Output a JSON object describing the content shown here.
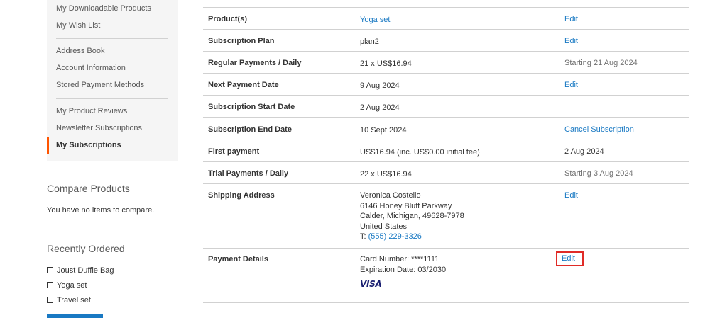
{
  "sidebar": {
    "nav_items": [
      "My Downloadable Products",
      "My Wish List",
      "Address Book",
      "Account Information",
      "Stored Payment Methods",
      "My Product Reviews",
      "Newsletter Subscriptions",
      "My Subscriptions"
    ],
    "compare": {
      "title": "Compare Products",
      "empty_text": "You have no items to compare."
    },
    "recently_ordered": {
      "title": "Recently Ordered",
      "items": [
        "Joust Duffle Bag",
        "Yoga set",
        "Travel set"
      ]
    }
  },
  "subscription": {
    "rows": [
      {
        "label": "Product(s)",
        "value": "Yoga set",
        "action": "Edit"
      },
      {
        "label": "Subscription Plan",
        "value": "plan2",
        "action": "Edit"
      },
      {
        "label": "Regular Payments / Daily",
        "value": "21 x US$16.94",
        "action": "Starting 21 Aug 2024"
      },
      {
        "label": "Next Payment Date",
        "value": "9 Aug 2024",
        "action": "Edit"
      },
      {
        "label": "Subscription Start Date",
        "value": "2 Aug 2024",
        "action": ""
      },
      {
        "label": "Subscription End Date",
        "value": "10 Sept 2024",
        "action": "Cancel Subscription"
      },
      {
        "label": "First payment",
        "value": "US$16.94 (inc. US$0.00 initial fee)",
        "action": "2 Aug 2024"
      },
      {
        "label": "Trial Payments / Daily",
        "value": "22 x US$16.94",
        "action": "Starting 3 Aug 2024"
      }
    ],
    "shipping": {
      "label": "Shipping Address",
      "name": "Veronica Costello",
      "street": "6146 Honey Bluff Parkway",
      "city_line": "Calder, Michigan, 49628-7978",
      "country": "United States",
      "phone_prefix": "T:",
      "phone": "(555) 229-3326",
      "action": "Edit"
    },
    "payment": {
      "label": "Payment Details",
      "card_number": "Card Number: ****1111",
      "expiration": "Expiration Date: 03/2030",
      "card_brand": "VISA",
      "action": "Edit"
    }
  },
  "colors": {
    "link": "#1979c3",
    "accent": "#ff5501",
    "highlight": "#e02b27"
  }
}
